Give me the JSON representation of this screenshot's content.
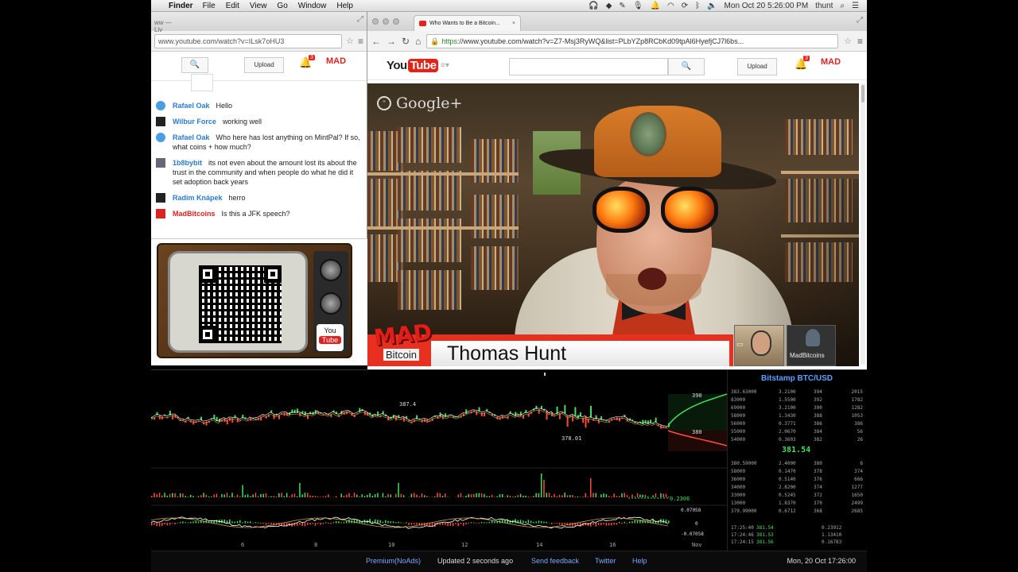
{
  "menubar": {
    "app": "Finder",
    "menus": [
      "File",
      "Edit",
      "View",
      "Go",
      "Window",
      "Help"
    ],
    "clock": "Mon Oct 20  5:26:00 PM",
    "user": "thunt"
  },
  "left_browser": {
    "tab_title": "ww — Liv",
    "url": "www.youtube.com/watch?v=ILsk7oHU3",
    "header": {
      "upload_label": "Upload",
      "notification_count": "3",
      "mad_logo": "MAD"
    },
    "chat": [
      {
        "name": "Rafael Oak",
        "message": "Hello",
        "avatar": "blue"
      },
      {
        "name": "Wilbur Force",
        "message": "working well",
        "avatar": "dark"
      },
      {
        "name": "Rafael Oak",
        "message": "Who here has lost anything on MintPal? If so, what coins + how much?",
        "avatar": "blue"
      },
      {
        "name": "1b8bybit",
        "message": "its not even about the amount lost its about the trust in the community and when people do what he did it set adoption back years",
        "avatar": "gray"
      },
      {
        "name": "Radim Knápek",
        "message": "herro",
        "avatar": "dark"
      },
      {
        "name": "MadBitcoins",
        "message": "Is this a JFK speech?",
        "avatar": "red"
      }
    ]
  },
  "tv_widget": {
    "logo_top": "You",
    "logo_bottom": "Tube"
  },
  "main_browser": {
    "tab_title": "Who Wants to Be a Bitcoin...",
    "url_scheme": "https",
    "url_rest": "://www.youtube.com/watch?v=Z7-Msj3RyWQ&list=PLbYZp8RCbKd09tpAl6HyefjCJ7l6bs...",
    "header": {
      "logo_you": "You",
      "logo_tube": "Tube",
      "search_button": "🔍",
      "upload_label": "Upload",
      "notification_count": "3",
      "mad_logo": "MAD"
    },
    "video": {
      "platform": "Google+",
      "lower_third_name": "Thomas Hunt",
      "lower_third_logo_top": "MAD",
      "lower_third_logo_bottom": "Bitcoin",
      "thumbnail_label": "MadBitcoins"
    }
  },
  "ticker": {
    "title": "Bitstamp BTC/USD",
    "chart_labels": {
      "high": "387.4",
      "low": "378.01",
      "ask_label": "390",
      "bid_label": "380",
      "volume_label": "0.2306",
      "osc_top": "0.07058",
      "osc_zero": "0",
      "osc_bottom": "-0.07058"
    },
    "x_ticks": [
      "6",
      "8",
      "10",
      "12",
      "14",
      "16",
      "Nov"
    ],
    "asks": [
      [
        "383.63000",
        "3.2100",
        "394",
        "2015"
      ],
      [
        "83000",
        "1.5500",
        "392",
        "1782"
      ],
      [
        "69000",
        "3.2100",
        "390",
        "1282"
      ],
      [
        "58000",
        "1.3430",
        "388",
        "1053"
      ],
      [
        "56000",
        "0.3771",
        "386",
        "386"
      ],
      [
        "55000",
        "2.0670",
        "384",
        "56"
      ],
      [
        "54000",
        "0.3603",
        "382",
        "26"
      ]
    ],
    "last_price": "381.54",
    "bids": [
      [
        "380.59000",
        "2.4000",
        "380",
        "6"
      ],
      [
        "58000",
        "0.1470",
        "378",
        "374"
      ],
      [
        "36000",
        "0.5140",
        "376",
        "666"
      ],
      [
        "34000",
        "2.8200",
        "374",
        "1277"
      ],
      [
        "33000",
        "0.5245",
        "372",
        "1650"
      ],
      [
        "13000",
        "1.8370",
        "370",
        "2499"
      ],
      [
        "379.99000",
        "0.6712",
        "368",
        "2685"
      ]
    ],
    "trades": [
      [
        "17:25:40",
        "381.54",
        "0.23912",
        "green"
      ],
      [
        "17:24:46",
        "381.53",
        "1.13410",
        "green"
      ],
      [
        "17:24:15",
        "381.56",
        "0.16783",
        "green"
      ]
    ]
  },
  "footer": {
    "premium": "Premium(NoAds)",
    "updated": "Updated 2 seconds ago",
    "feedback": "Send feedback",
    "twitter": "Twitter",
    "help": "Help",
    "date": "Mon, 20 Oct 17:26:00"
  },
  "colors": {
    "up": "#3fe05a",
    "down": "#ff4a3a",
    "accent": "#e62117",
    "link": "#7aa8ff"
  }
}
